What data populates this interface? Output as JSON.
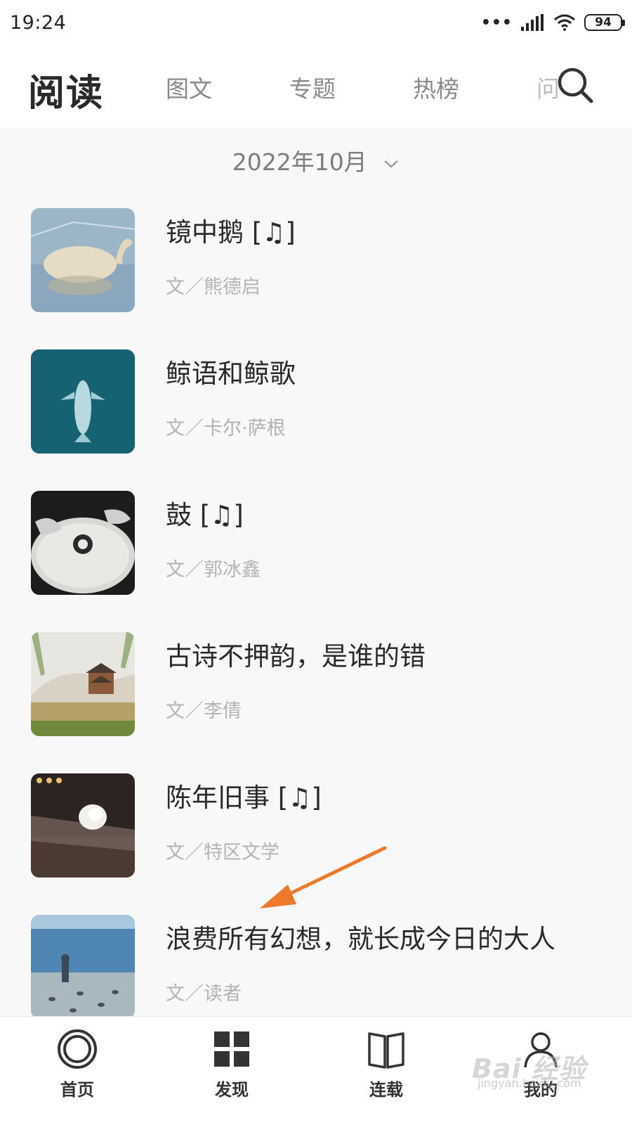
{
  "status_bar": {
    "time": "19:24",
    "battery": "94"
  },
  "header": {
    "title": "阅读",
    "tabs": [
      "图文",
      "专题",
      "热榜",
      "问"
    ]
  },
  "month": {
    "label": "2022年10月"
  },
  "articles": [
    {
      "title": "镜中鹅 [♫]",
      "author": "文／熊德启",
      "thumb": "swan"
    },
    {
      "title": "鲸语和鲸歌",
      "author": "文／卡尔·萨根",
      "thumb": "whale"
    },
    {
      "title": "鼓 [♫]",
      "author": "文／郭冰鑫",
      "thumb": "drum"
    },
    {
      "title": "古诗不押韵，是谁的错",
      "author": "文／李倩",
      "thumb": "pavilion"
    },
    {
      "title": "陈年旧事 [♫]",
      "author": "文／特区文学",
      "thumb": "flower"
    },
    {
      "title": "浪费所有幻想，就长成今日的大人",
      "author": "文／读者",
      "thumb": "seaside"
    }
  ],
  "bottom_nav": [
    {
      "label": "首页",
      "icon": "home-ring-icon"
    },
    {
      "label": "发现",
      "icon": "grid-icon"
    },
    {
      "label": "连载",
      "icon": "book-icon"
    },
    {
      "label": "我的",
      "icon": "user-icon"
    }
  ],
  "watermark": {
    "brand": "Bai 经验",
    "url": "jingyan.baidu.com"
  },
  "colors": {
    "annotation_arrow": "#f07a2c",
    "background": "#f8f8f8"
  }
}
